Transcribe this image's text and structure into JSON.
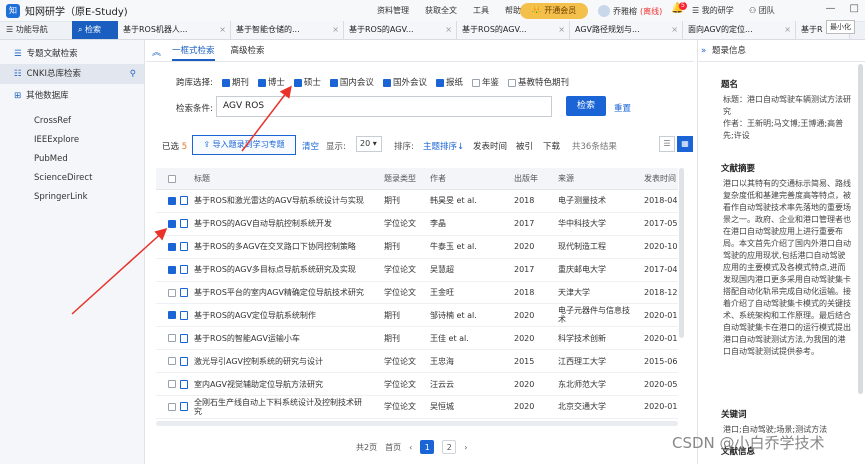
{
  "app": {
    "title": "知网研学（原E-Study)"
  },
  "top_menu": [
    "资料管理",
    "获取全文",
    "工具",
    "帮助"
  ],
  "vip_label": "开通会员",
  "user": {
    "name": "乔雅榕",
    "status": "(离线)"
  },
  "notification_count": "5",
  "my_work": "我的研学",
  "team": "团队",
  "tooltip": "最小化",
  "nav_tabs": [
    "功能导航",
    "检索"
  ],
  "doc_tabs": [
    "基于ROS机器人...",
    "基于智能仓储的...",
    "基于ROS的AGV...",
    "基于ROS的AGV...",
    "AGV路径规划与...",
    "面向AGV的定位...",
    "基于R"
  ],
  "left_nav": {
    "items": [
      {
        "label": "专题文献检索"
      },
      {
        "label": "CNKI总库检索"
      },
      {
        "label": "其他数据库"
      }
    ],
    "sub_items": [
      "CrossRef",
      "IEEExplore",
      "PubMed",
      "ScienceDirect",
      "SpringerLink"
    ]
  },
  "search_tabs": [
    "一框式检索",
    "高级检索"
  ],
  "cross_db": {
    "label": "跨库选择:",
    "options": [
      {
        "label": "期刊",
        "checked": true
      },
      {
        "label": "博士",
        "checked": true
      },
      {
        "label": "硕士",
        "checked": true
      },
      {
        "label": "国内会议",
        "checked": true
      },
      {
        "label": "国外会议",
        "checked": true
      },
      {
        "label": "报纸",
        "checked": true
      },
      {
        "label": "年鉴",
        "checked": false
      },
      {
        "label": "基教特色期刊",
        "checked": false
      }
    ]
  },
  "search": {
    "label": "检索条件:",
    "value": "AGV ROS",
    "button": "检索",
    "reset": "重置"
  },
  "toolbar": {
    "selected_label": "已选",
    "selected_count": "5",
    "import_button": "导入题录到学习专题",
    "clear": "清空",
    "show_label": "显示:",
    "page_size": "20",
    "sort_label": "排序:",
    "sort_options": [
      "主题排序↓",
      "发表时间",
      "被引",
      "下载"
    ],
    "total": "共36条结果"
  },
  "table": {
    "headers": [
      "标题",
      "题录类型",
      "作者",
      "出版年",
      "来源",
      "发表时间"
    ],
    "rows": [
      {
        "checked": true,
        "title": "基于ROS和激光雷达的AGV导航系统设计与实现",
        "type": "期刊",
        "author": "韩昊旻 et al.",
        "year": "2018",
        "source": "电子测量技术",
        "date": "2018-04"
      },
      {
        "checked": true,
        "title": "基于ROS的AGV自动导航控制系统开发",
        "type": "学位论文",
        "author": "李晶",
        "year": "2017",
        "source": "华中科技大学",
        "date": "2017-05"
      },
      {
        "checked": true,
        "title": "基于ROS的多AGV在交叉路口下协同控制策略",
        "type": "期刊",
        "author": "牛泰玉 et al.",
        "year": "2020",
        "source": "现代制造工程",
        "date": "2020-10"
      },
      {
        "checked": true,
        "title": "基于ROS的AGV多目标点导航系统研究及实现",
        "type": "学位论文",
        "author": "吴慧超",
        "year": "2017",
        "source": "重庆邮电大学",
        "date": "2017-04"
      },
      {
        "checked": false,
        "title": "基于ROS平台的室内AGV精确定位导航技术研究",
        "type": "学位论文",
        "author": "王金旺",
        "year": "2018",
        "source": "天津大学",
        "date": "2018-12"
      },
      {
        "checked": true,
        "title": "基于ROS的AGV定位导航系统制作",
        "type": "期刊",
        "author": "邹诗楠 et al.",
        "year": "2020",
        "source": "电子元器件与信息技术",
        "date": "2020-01"
      },
      {
        "checked": false,
        "title": "基于ROS的智能AGV运输小车",
        "type": "期刊",
        "author": "王佳 et al.",
        "year": "2020",
        "source": "科学技术创新",
        "date": "2020-01"
      },
      {
        "checked": false,
        "title": "激光导引AGV控制系统的研究与设计",
        "type": "学位论文",
        "author": "王忠海",
        "year": "2015",
        "source": "江西理工大学",
        "date": "2015-06"
      },
      {
        "checked": false,
        "title": "室内AGV视觉辅助定位导航方法研究",
        "type": "学位论文",
        "author": "汪云云",
        "year": "2020",
        "source": "东北师范大学",
        "date": "2020-05"
      },
      {
        "checked": false,
        "title": "全刚石生产线自动上下料系统设计及控制技术研究",
        "type": "学位论文",
        "author": "吴恒城",
        "year": "2020",
        "source": "北京交通大学",
        "date": "2020-01"
      }
    ]
  },
  "pager": {
    "total_pages": "共2页",
    "first": "首页",
    "pages": [
      "1",
      "2"
    ]
  },
  "right_panel": {
    "header": "题录信息",
    "sections": [
      {
        "title": "题名",
        "text": "标题：港口自动驾驶车辆测试方法研究\n作者：王新明;马文博;王博通;高普先;许设"
      },
      {
        "title": "文献摘要",
        "text": "港口以其特有的交通标示简易、路线复杂度低和基建完善度高等特点，被看作自动驾驶技术率先落地的重要场景之一。政府、企业和港口管理者也在港口自动驾驶应用上进行重要布局。本文首先介绍了国内外港口自动驾驶的应用现状,包括港口自动驾驶应用的主要模式及各模式特点,进而发现国内港口更多采用自动驾驶集卡搭配自动化轨吊完成自动化运输。接着介绍了自动驾驶集卡模式的关键技术、系统架构和工作原理。最后结合自动驾驶集卡在港口的运行模式提出港口自动驾驶测试方法,为我国的港口自动驾驶测试提供参考。"
      },
      {
        "title": "关键词",
        "text": "港口;自动驾驶;场景;测试方法"
      },
      {
        "title": "文献信息",
        "text": ""
      }
    ]
  },
  "watermark": "CSDN @小白乔学技术",
  "colors": {
    "accent": "#1a64d6",
    "vip": "#f4c04c",
    "annotation_arrow": "#e8322a"
  }
}
